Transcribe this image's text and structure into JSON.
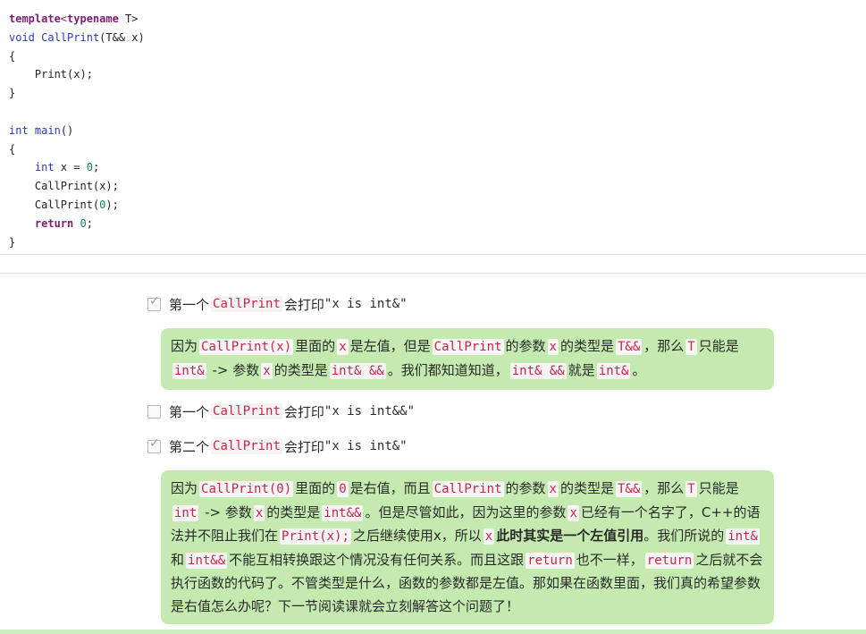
{
  "code": {
    "l1": {
      "kw1": "template",
      "lt": "<",
      "kw2": "typename",
      "rest": " T>"
    },
    "l2": {
      "ty": "void",
      "sp": " ",
      "fn": "CallPrint",
      "rest": "(T&& x)"
    },
    "l3": "{",
    "l4": "    Print(x);",
    "l5": "}",
    "l7": {
      "ty": "int",
      "sp": " ",
      "fn": "main",
      "rest": "()"
    },
    "l8": "{",
    "l9": {
      "ind": "    ",
      "ty": "int",
      "mid": " x = ",
      "num": "0",
      "end": ";"
    },
    "l10": "    CallPrint(x);",
    "l11": {
      "pre": "    CallPrint(",
      "num": "0",
      "end": ");"
    },
    "l12": {
      "ind": "    ",
      "kw": "return",
      "sp": " ",
      "num": "0",
      "end": ";"
    },
    "l13": "}"
  },
  "options": [
    {
      "checked": true,
      "pre": "第一个",
      "code": "CallPrint",
      "mid": "会打印",
      "str": "\"x is int&\""
    },
    {
      "checked": false,
      "pre": "第一个",
      "code": "CallPrint",
      "mid": "会打印",
      "str": "\"x is int&&\""
    },
    {
      "checked": true,
      "pre": "第二个",
      "code": "CallPrint",
      "mid": "会打印",
      "str": "\"x is int&\""
    }
  ],
  "explain1": {
    "t1": "因为",
    "c1": "CallPrint(x)",
    "t2": "里面的",
    "c2": "x",
    "t3": "是左值，但是",
    "c3": "CallPrint",
    "t4": "的参数",
    "c4": "x",
    "t5": "的类型是",
    "c5": "T&&",
    "t6": "，那么",
    "c6": "T",
    "t7": "只能是",
    "c7": "int&",
    "t8": " -> 参数",
    "c8": "x",
    "t9": "的类型是",
    "c9": "int& &&",
    "t10": "。我们都知道知道，",
    "c10": "int& &&",
    "t11": "就是",
    "c11": "int&",
    "t12": "。"
  },
  "explain2": {
    "t1": "因为",
    "c1": "CallPrint(0)",
    "t2": "里面的",
    "c2": "0",
    "t3": "是右值，而且",
    "c3": "CallPrint",
    "t4": "的参数",
    "c4": "x",
    "t5": "的类型是",
    "c5": "T&&",
    "t6": "，那么",
    "c6": "T",
    "t7": "只能是",
    "c7": "int",
    "t8": " -> 参数",
    "c8": "x",
    "t9": "的类型是",
    "c9": "int&&",
    "t10": "。但是尽管如此，因为这里的参数",
    "c10": "x",
    "t11": "已经有一个名字了，C++的语法并不阻止我们在",
    "c11": "Print(x);",
    "t12": "之后继续使用x，所以",
    "c12": "x",
    "b1": "此时其实是一个左值引用",
    "t13": "。我们所说的",
    "c13": "int&",
    "t14": "和",
    "c14": "int&&",
    "t15": "不能互相转换跟这个情况没有任何关系。而且这跟",
    "c15": "return",
    "t16": "也不一样，",
    "c16": "return",
    "t17": "之后就不会执行函数的代码了。不管类型是什么，函数的参数都是左值。那如果在函数里面，我们真的希望参数是右值怎么办呢？下一节阅读课就会立刻解答这个问题了！"
  }
}
